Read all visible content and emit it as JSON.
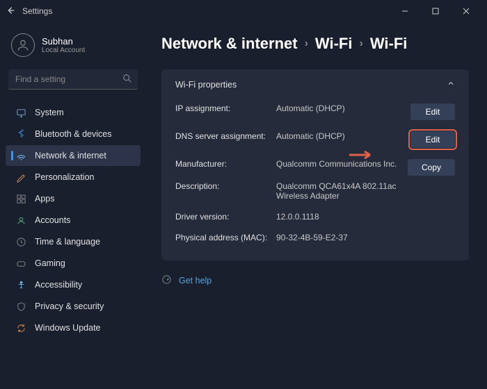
{
  "window": {
    "title": "Settings"
  },
  "account": {
    "name": "Subhan",
    "type": "Local Account"
  },
  "search": {
    "placeholder": "Find a setting"
  },
  "sidebar": {
    "items": [
      {
        "label": "System"
      },
      {
        "label": "Bluetooth & devices"
      },
      {
        "label": "Network & internet"
      },
      {
        "label": "Personalization"
      },
      {
        "label": "Apps"
      },
      {
        "label": "Accounts"
      },
      {
        "label": "Time & language"
      },
      {
        "label": "Gaming"
      },
      {
        "label": "Accessibility"
      },
      {
        "label": "Privacy & security"
      },
      {
        "label": "Windows Update"
      }
    ]
  },
  "breadcrumb": {
    "a": "Network & internet",
    "b": "Wi-Fi",
    "c": "Wi-Fi"
  },
  "panel": {
    "title": "Wi-Fi properties",
    "rows": {
      "ip_label": "IP assignment:",
      "ip_value": "Automatic (DHCP)",
      "dns_label": "DNS server assignment:",
      "dns_value": "Automatic (DHCP)",
      "manu_label": "Manufacturer:",
      "manu_value": "Qualcomm Communications Inc.",
      "desc_label": "Description:",
      "desc_value": "Qualcomm QCA61x4A 802.11ac Wireless Adapter",
      "drv_label": "Driver version:",
      "drv_value": "12.0.0.1118",
      "mac_label": "Physical address (MAC):",
      "mac_value": "90-32-4B-59-E2-37"
    },
    "buttons": {
      "edit": "Edit",
      "copy": "Copy"
    }
  },
  "help": {
    "label": "Get help"
  }
}
